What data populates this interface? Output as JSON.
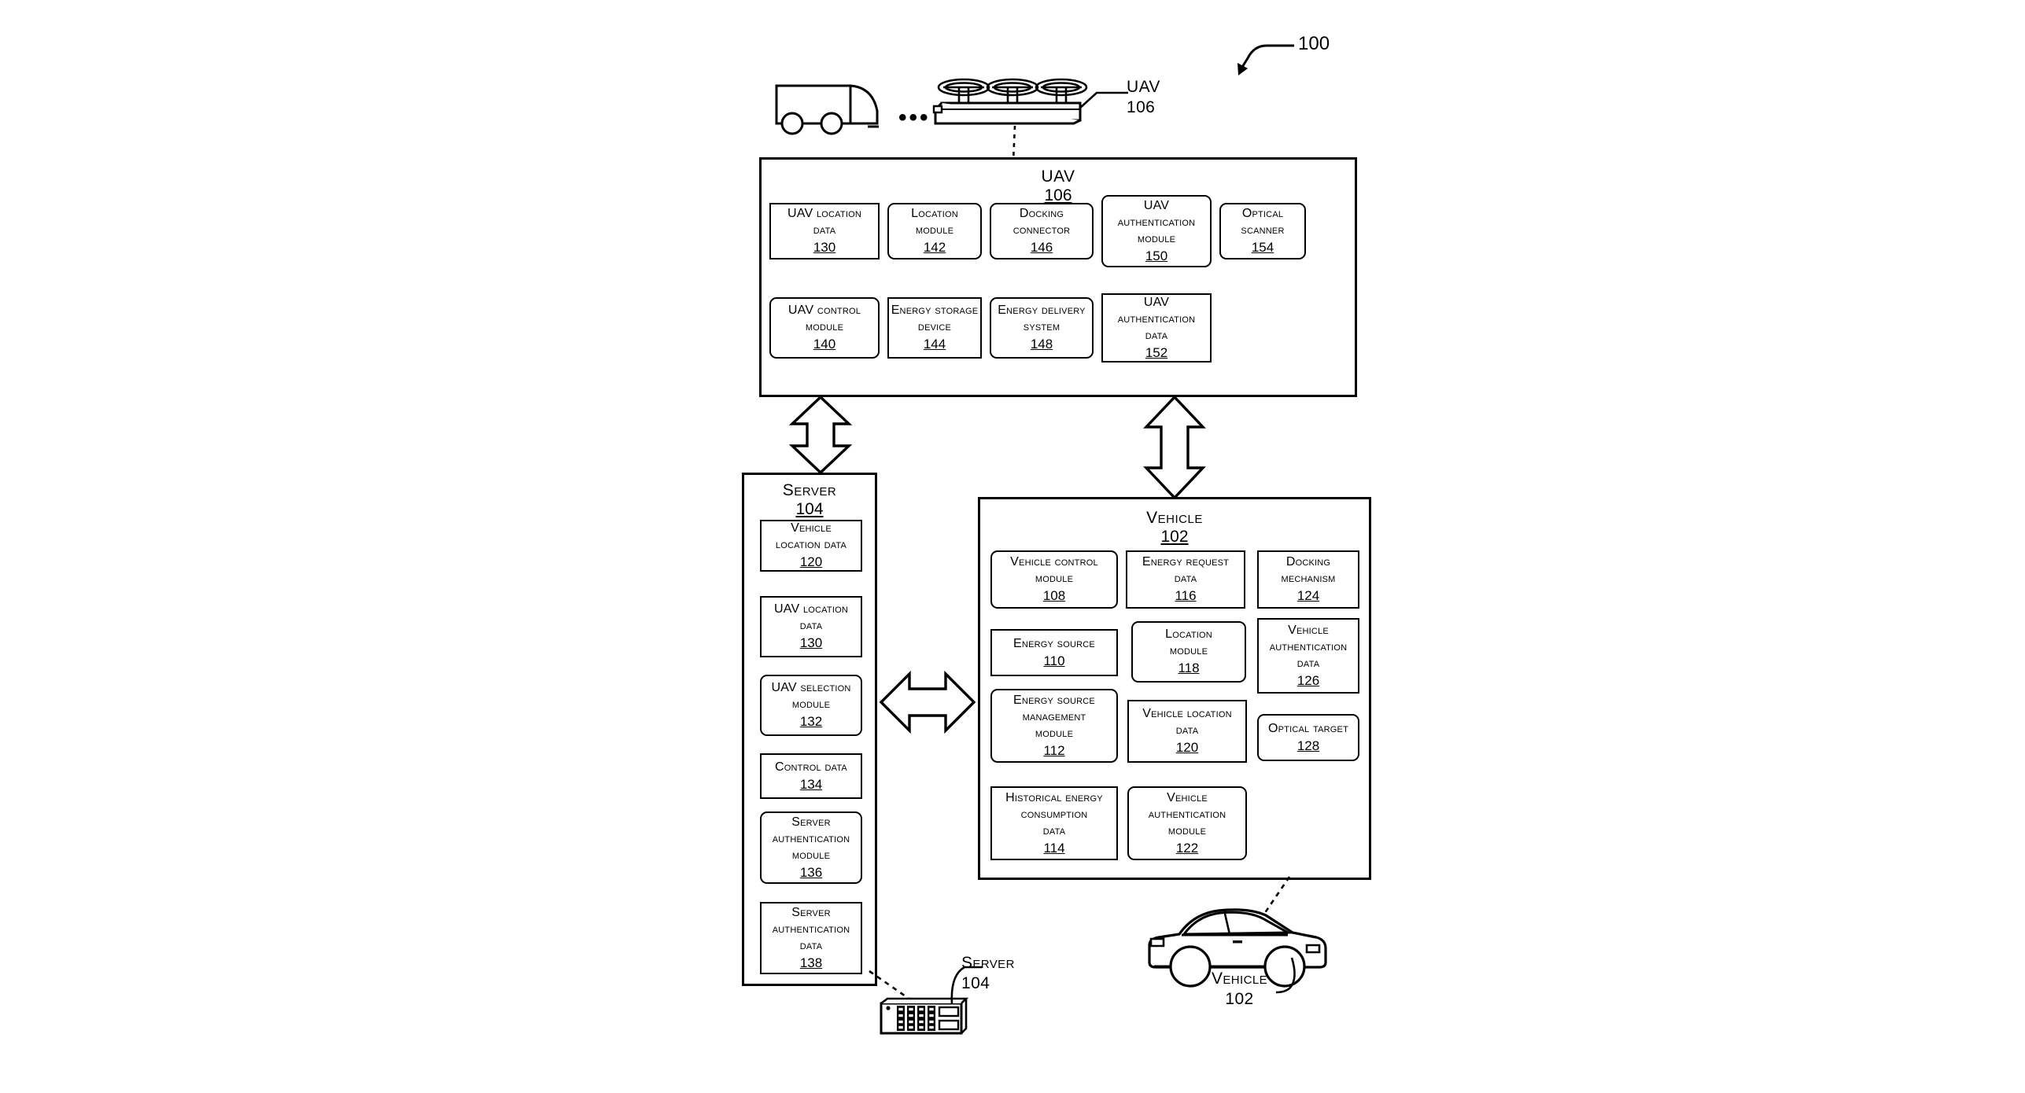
{
  "figure": {
    "reference_numeral": "100"
  },
  "top_illustration": {
    "truck_label": "truck-icon",
    "ellipsis": "•••",
    "uav_callout": {
      "label": "UAV",
      "num": "106"
    }
  },
  "uav_block": {
    "title": "UAV",
    "num": "106",
    "cells": [
      {
        "lines": [
          "UAV location",
          "data"
        ],
        "num": "130",
        "rounded": false
      },
      {
        "lines": [
          "Location",
          "module"
        ],
        "num": "142",
        "rounded": true
      },
      {
        "lines": [
          "Docking",
          "connector"
        ],
        "num": "146",
        "rounded": true
      },
      {
        "lines": [
          "UAV",
          "authentication",
          "module"
        ],
        "num": "150",
        "rounded": true
      },
      {
        "lines": [
          "Optical",
          "scanner"
        ],
        "num": "154",
        "rounded": true
      },
      {
        "lines": [
          "UAV control",
          "module"
        ],
        "num": "140",
        "rounded": true
      },
      {
        "lines": [
          "Energy storage",
          "device"
        ],
        "num": "144",
        "rounded": false
      },
      {
        "lines": [
          "Energy delivery",
          "system"
        ],
        "num": "148",
        "rounded": true
      },
      {
        "lines": [
          "UAV",
          "authentication",
          "data"
        ],
        "num": "152",
        "rounded": false
      }
    ]
  },
  "server_block": {
    "title": "Server",
    "num": "104",
    "cells": [
      {
        "lines": [
          "Vehicle",
          "location data"
        ],
        "num": "120",
        "rounded": false
      },
      {
        "lines": [
          "UAV location",
          "data"
        ],
        "num": "130",
        "rounded": false
      },
      {
        "lines": [
          "UAV selection",
          "module"
        ],
        "num": "132",
        "rounded": true
      },
      {
        "lines": [
          "Control data"
        ],
        "num": "134",
        "rounded": false
      },
      {
        "lines": [
          "Server",
          "authentication",
          "module"
        ],
        "num": "136",
        "rounded": true
      },
      {
        "lines": [
          "Server",
          "authentication",
          "data"
        ],
        "num": "138",
        "rounded": false
      }
    ]
  },
  "vehicle_block": {
    "title": "Vehicle",
    "num": "102",
    "cells": [
      {
        "lines": [
          "Vehicle control",
          "module"
        ],
        "num": "108",
        "rounded": true
      },
      {
        "lines": [
          "Energy request",
          "data"
        ],
        "num": "116",
        "rounded": false
      },
      {
        "lines": [
          "Docking",
          "mechanism"
        ],
        "num": "124",
        "rounded": false
      },
      {
        "lines": [
          "Energy source"
        ],
        "num": "110",
        "rounded": false
      },
      {
        "lines": [
          "Location",
          "module"
        ],
        "num": "118",
        "rounded": true
      },
      {
        "lines": [
          "Vehicle",
          "authentication",
          "data"
        ],
        "num": "126",
        "rounded": false
      },
      {
        "lines": [
          "Energy source",
          "management",
          "module"
        ],
        "num": "112",
        "rounded": true
      },
      {
        "lines": [
          "Vehicle location",
          "data"
        ],
        "num": "120",
        "rounded": false
      },
      {
        "lines": [
          "Optical target"
        ],
        "num": "128",
        "rounded": true
      },
      {
        "lines": [
          "Historical energy",
          "consumption",
          "data"
        ],
        "num": "114",
        "rounded": false
      },
      {
        "lines": [
          "Vehicle",
          "authentication",
          "module"
        ],
        "num": "122",
        "rounded": true
      }
    ]
  },
  "server_callout": {
    "label": "Server",
    "num": "104"
  },
  "vehicle_callout": {
    "label": "Vehicle",
    "num": "102"
  },
  "arrows": {
    "uav_server": "double-headed-vertical-arrow",
    "uav_vehicle": "double-headed-vertical-arrow",
    "server_vehicle": "double-headed-horizontal-arrow"
  },
  "colors": {
    "ink": "#000000",
    "paper": "#ffffff"
  }
}
